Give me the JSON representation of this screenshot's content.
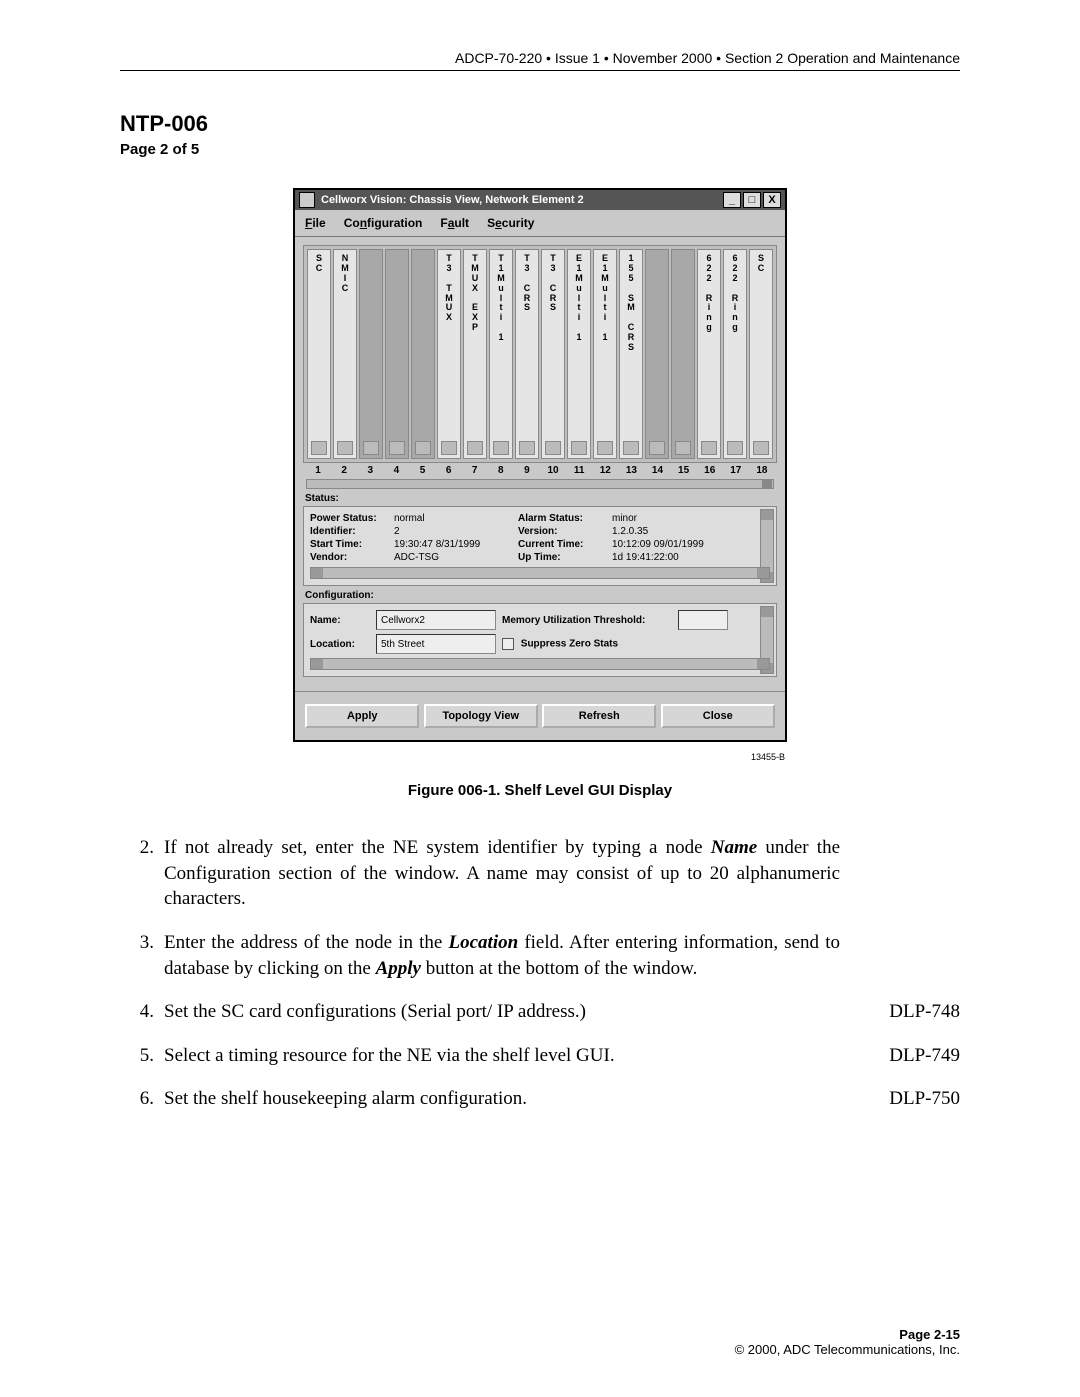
{
  "doc": {
    "header": "ADCP-70-220 • Issue 1 • November 2000 • Section 2 Operation and Maintenance",
    "title": "NTP-006",
    "subtitle": "Page 2 of 5",
    "fig_id": "13455-B",
    "fig_caption": "Figure 006-1. Shelf Level GUI Display",
    "footer_page": "Page 2-15",
    "footer_copy": "© 2000, ADC Telecommunications, Inc."
  },
  "gui": {
    "title": "Cellworx Vision:   Chassis View,    Network Element 2",
    "win_min": "_",
    "win_max": "□",
    "win_close": "X",
    "menu": {
      "file": "File",
      "config": "Configuration",
      "fault": "Fault",
      "security": "Security"
    },
    "slots": [
      {
        "n": "1",
        "populated": true,
        "label": "S\nC"
      },
      {
        "n": "2",
        "populated": true,
        "label": "N\nM\nI\nC"
      },
      {
        "n": "3",
        "populated": false,
        "label": ""
      },
      {
        "n": "4",
        "populated": false,
        "label": ""
      },
      {
        "n": "5",
        "populated": false,
        "label": ""
      },
      {
        "n": "6",
        "populated": true,
        "label": "T\n3\n\nT\nM\nU\nX"
      },
      {
        "n": "7",
        "populated": true,
        "label": "T\nM\nU\nX\n\nE\nX\nP"
      },
      {
        "n": "8",
        "populated": true,
        "label": "T\n1\nM\nu\nl\nt\ni\n\n1"
      },
      {
        "n": "9",
        "populated": true,
        "label": "T\n3\n\nC\nR\nS"
      },
      {
        "n": "10",
        "populated": true,
        "label": "T\n3\n\nC\nR\nS"
      },
      {
        "n": "11",
        "populated": true,
        "label": "E\n1\nM\nu\nl\nt\ni\n\n1"
      },
      {
        "n": "12",
        "populated": true,
        "label": "E\n1\nM\nu\nl\nt\ni\n\n1"
      },
      {
        "n": "13",
        "populated": true,
        "label": "1\n5\n5\n\nS\nM\n\nC\nR\nS"
      },
      {
        "n": "14",
        "populated": false,
        "label": ""
      },
      {
        "n": "15",
        "populated": false,
        "label": ""
      },
      {
        "n": "16",
        "populated": true,
        "label": "6\n2\n2\n\nR\ni\nn\ng"
      },
      {
        "n": "17",
        "populated": true,
        "label": "6\n2\n2\n\nR\ni\nn\ng"
      },
      {
        "n": "18",
        "populated": true,
        "label": "S\nC"
      }
    ],
    "status": {
      "label": "Status:",
      "power_status_l": "Power Status:",
      "power_status_v": "normal",
      "identifier_l": "Identifier:",
      "identifier_v": "2",
      "start_time_l": "Start Time:",
      "start_time_v": "19:30:47 8/31/1999",
      "vendor_l": "Vendor:",
      "vendor_v": "ADC-TSG",
      "alarm_status_l": "Alarm Status:",
      "alarm_status_v": "minor",
      "version_l": "Version:",
      "version_v": "1.2.0.35",
      "current_time_l": "Current Time:",
      "current_time_v": "10:12:09 09/01/1999",
      "up_time_l": "Up Time:",
      "up_time_v": "1d 19:41:22:00"
    },
    "config": {
      "label": "Configuration:",
      "name_l": "Name:",
      "name_v": "Cellworx2",
      "location_l": "Location:",
      "location_v": "5th Street",
      "mem_thresh_l": "Memory Utilization Threshold:",
      "suppress_l": "Suppress Zero Stats"
    },
    "buttons": {
      "apply": "Apply",
      "topology": "Topology View",
      "refresh": "Refresh",
      "close": "Close"
    }
  },
  "steps": [
    {
      "num": "2.",
      "text_parts": [
        "If not already set, enter the NE system identifier by typing a node ",
        "Name",
        " under the Configuration section of the window. A name may consist of up to 20 alphanumeric characters."
      ],
      "ref": ""
    },
    {
      "num": "3.",
      "text_parts": [
        "Enter the address of the node in the ",
        "Location",
        " field. After entering information, send to database by clicking on the ",
        "Apply",
        " button at the bottom of the window."
      ],
      "ref": ""
    },
    {
      "num": "4.",
      "text_parts": [
        "Set the SC card configurations (Serial port/ IP address.)"
      ],
      "ref": "DLP-748"
    },
    {
      "num": "5.",
      "text_parts": [
        "Select a timing resource for the NE via the shelf level GUI."
      ],
      "ref": "DLP-749"
    },
    {
      "num": "6.",
      "text_parts": [
        "Set the shelf housekeeping alarm configuration."
      ],
      "ref": "DLP-750"
    }
  ]
}
